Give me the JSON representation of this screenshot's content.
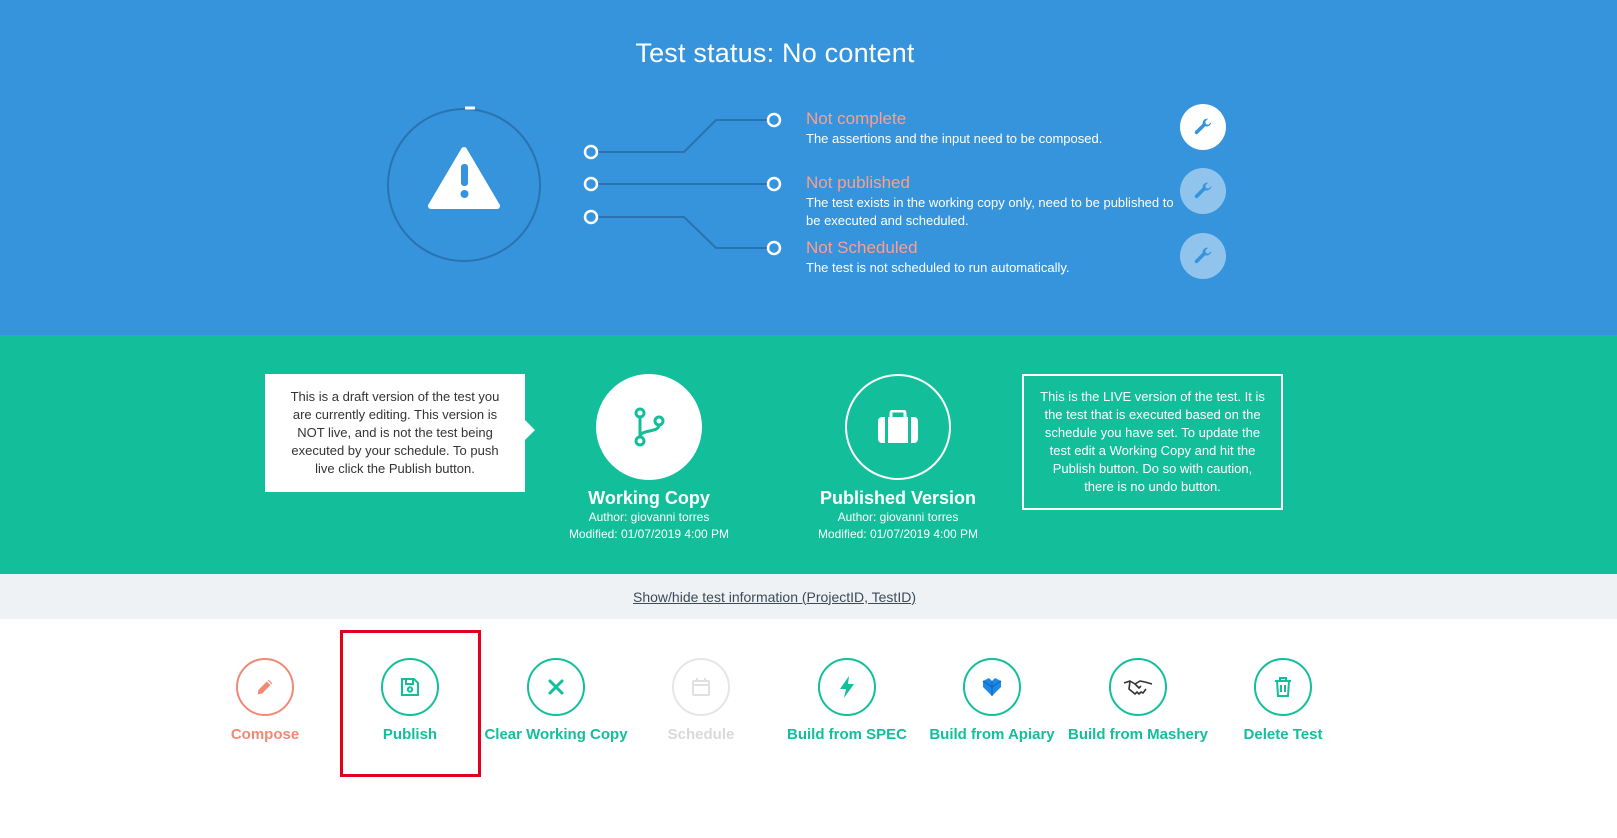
{
  "status": {
    "title": "Test status: No content",
    "rows": [
      {
        "label": "Not complete",
        "description": "The assertions and the input need to be composed."
      },
      {
        "label": "Not published",
        "description": "The test exists in the working copy only, need to be published to be executed and scheduled."
      },
      {
        "label": "Not Scheduled",
        "description": "The test is not scheduled to run automatically."
      }
    ],
    "status_icon": "warning-triangle-icon",
    "row_action_icon": "wrench-icon"
  },
  "versions": {
    "draft_note": "This is a draft version of the test you are currently editing. This version is NOT live, and is not the test being executed by your schedule. To push live click the Publish button.",
    "live_note": "This is the LIVE version of the test. It is the test that is executed based on the schedule you have set. To update the test edit a Working Copy and hit the Publish button. Do so with caution, there is no undo button.",
    "working_copy": {
      "name": "Working Copy",
      "author": "Author: giovanni torres",
      "modified": "Modified: 01/07/2019 4:00 PM",
      "icon": "git-branch-icon"
    },
    "published_version": {
      "name": "Published Version",
      "author": "Author: giovanni torres",
      "modified": "Modified: 01/07/2019 4:00 PM",
      "icon": "briefcase-icon"
    }
  },
  "info_link": "Show/hide test information (ProjectID, TestID)",
  "actions": [
    {
      "label": "Compose",
      "icon": "pencil-icon"
    },
    {
      "label": "Publish",
      "icon": "floppy-disk-icon"
    },
    {
      "label": "Clear Working Copy",
      "icon": "close-icon"
    },
    {
      "label": "Schedule",
      "icon": "calendar-icon"
    },
    {
      "label": "Build from SPEC",
      "icon": "lightning-icon"
    },
    {
      "label": "Build from Apiary",
      "icon": "apiary-hexagon-icon"
    },
    {
      "label": "Build from Mashery",
      "icon": "handshake-icon"
    },
    {
      "label": "Delete Test",
      "icon": "trash-icon"
    }
  ],
  "colors": {
    "status_bg": "#3594dc",
    "versions_bg": "#12bf9a",
    "accent_green": "#12bf9a",
    "compose_coral": "#f08a76",
    "status_label": "#ff9e8a",
    "highlight": "#e3001b"
  }
}
